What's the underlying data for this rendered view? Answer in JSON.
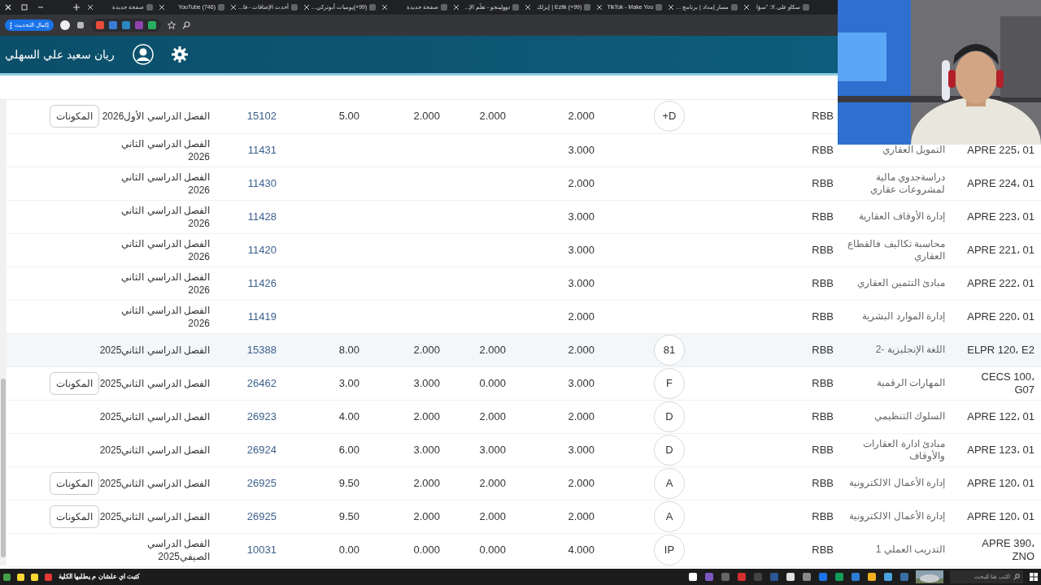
{
  "tabs": [
    {
      "title": "سكاو على X: \"سؤا"
    },
    {
      "title": "مسار إمداد | برنامج ..."
    },
    {
      "title": "TikTok - Make You"
    },
    {
      "title": "(99+) Ezlik | إيزلك"
    },
    {
      "title": "دوولينجو - تعلّم الإ..."
    },
    {
      "title": "صفحة جديدة"
    },
    {
      "title": "(99+)يوميات أبوتركي..."
    },
    {
      "title": "أحدث الإضافات - فا..."
    },
    {
      "title": "(746) YouTube"
    },
    {
      "title": "صفحة جديدة"
    }
  ],
  "toolbar": {
    "update_button": "إكمال التحديث"
  },
  "header": {
    "user_name": "ريان سعيد علي السهلي"
  },
  "table": {
    "rows": [
      {
        "highlighted": false,
        "column_3": "RBB",
        "grade": "+D",
        "column_6": "2.000",
        "column_7": "2.000",
        "column_8": "2.000",
        "column_9": "5.00",
        "column_10": "15102",
        "semester": "الفصل الدراسي الأول2026",
        "button": "المكونات"
      },
      {
        "highlighted": false,
        "code": "APRE 225، 01",
        "name": "التمويل العقاري",
        "column_3": "RBB",
        "column_6": "3.000",
        "column_10": "11431",
        "semester": "الفصل الدراسي الثاني\n2026"
      },
      {
        "highlighted": false,
        "code": "APRE 224، 01",
        "name": "دراسةجدوي مالية\nلمشروعات عقاري",
        "column_3": "RBB",
        "column_6": "2.000",
        "column_10": "11430",
        "semester": "الفصل الدراسي الثاني\n2026"
      },
      {
        "highlighted": false,
        "code": "APRE 223، 01",
        "name": "إدارة الأوقاف العقارية",
        "column_3": "RBB",
        "column_6": "3.000",
        "column_10": "11428",
        "semester": "الفصل الدراسي الثاني\n2026"
      },
      {
        "highlighted": false,
        "code": "APRE 221، 01",
        "name": "محاسبة تكاليف فالقطاع\nالعقاري",
        "column_3": "RBB",
        "column_6": "3.000",
        "column_10": "11420",
        "semester": "الفصل الدراسي الثاني\n2026"
      },
      {
        "highlighted": false,
        "code": "APRE 222، 01",
        "name": "مبادئ التثمين العقاري",
        "column_3": "RBB",
        "column_6": "3.000",
        "column_10": "11426",
        "semester": "الفصل الدراسي الثاني\n2026"
      },
      {
        "highlighted": false,
        "code": "APRE 220، 01",
        "name": "إدارة الموارد البشرية",
        "column_3": "RBB",
        "column_6": "2.000",
        "column_10": "11419",
        "semester": "الفصل الدراسي الثاني\n2026"
      },
      {
        "highlighted": true,
        "code": "ELPR 120، E2",
        "name": "اللغة الإنجليزية -2",
        "column_3": "RBB",
        "grade": "81",
        "column_6": "2.000",
        "column_7": "2.000",
        "column_8": "2.000",
        "column_9": "8.00",
        "column_10": "15388",
        "semester": "الفصل الدراسي الثاني2025"
      },
      {
        "highlighted": false,
        "code": "CECS 100،\nG07",
        "name": "المهارات الرقمية",
        "column_3": "RBB",
        "grade": "F",
        "column_6": "3.000",
        "column_7": "0.000",
        "column_8": "3.000",
        "column_9": "3.00",
        "column_10": "26462",
        "semester": "الفصل الدراسي الثاني2025",
        "button": "المكونات"
      },
      {
        "highlighted": false,
        "code": "APRE 122، 01",
        "name": "السلوك التنظيمي",
        "column_3": "RBB",
        "grade": "D",
        "column_6": "2.000",
        "column_7": "2.000",
        "column_8": "2.000",
        "column_9": "4.00",
        "column_10": "26923",
        "semester": "الفصل الدراسي الثاني2025"
      },
      {
        "highlighted": false,
        "code": "APRE 123، 01",
        "name": "مبادئ ادارة العقارات\nوالأوقاف",
        "column_3": "RBB",
        "grade": "D",
        "column_6": "3.000",
        "column_7": "3.000",
        "column_8": "3.000",
        "column_9": "6.00",
        "column_10": "26924",
        "semester": "الفصل الدراسي الثاني2025"
      },
      {
        "highlighted": false,
        "code": "APRE 120، 01",
        "name": "إدارة الأعمال الالكترونية",
        "column_3": "RBB",
        "grade": "A",
        "column_6": "2.000",
        "column_7": "2.000",
        "column_8": "2.000",
        "column_9": "9.50",
        "column_10": "26925",
        "semester": "الفصل الدراسي الثاني2025",
        "button": "المكونات"
      },
      {
        "highlighted": false,
        "code": "APRE 120، 01",
        "name": "إدارة الأعمال الالكترونية",
        "column_3": "RBB",
        "grade": "A",
        "column_6": "2.000",
        "column_7": "2.000",
        "column_8": "2.000",
        "column_9": "9.50",
        "column_10": "26925",
        "semester": "الفصل الدراسي الثاني2025",
        "button": "المكونات"
      },
      {
        "highlighted": false,
        "code": "APRE 390،\nZNO",
        "name": "التدريب العملي 1",
        "column_3": "RBB",
        "grade": "IP",
        "column_6": "4.000",
        "column_7": "0.000",
        "column_8": "0.000",
        "column_9": "0.00",
        "column_10": "10031",
        "semester": "الفصل الدراسي\nالصيفي2025"
      }
    ]
  },
  "taskbar": {
    "ticker": "كتبت اي علشان م يطلبها الكلية",
    "search_placeholder": "اكتب هنا للبحث"
  }
}
